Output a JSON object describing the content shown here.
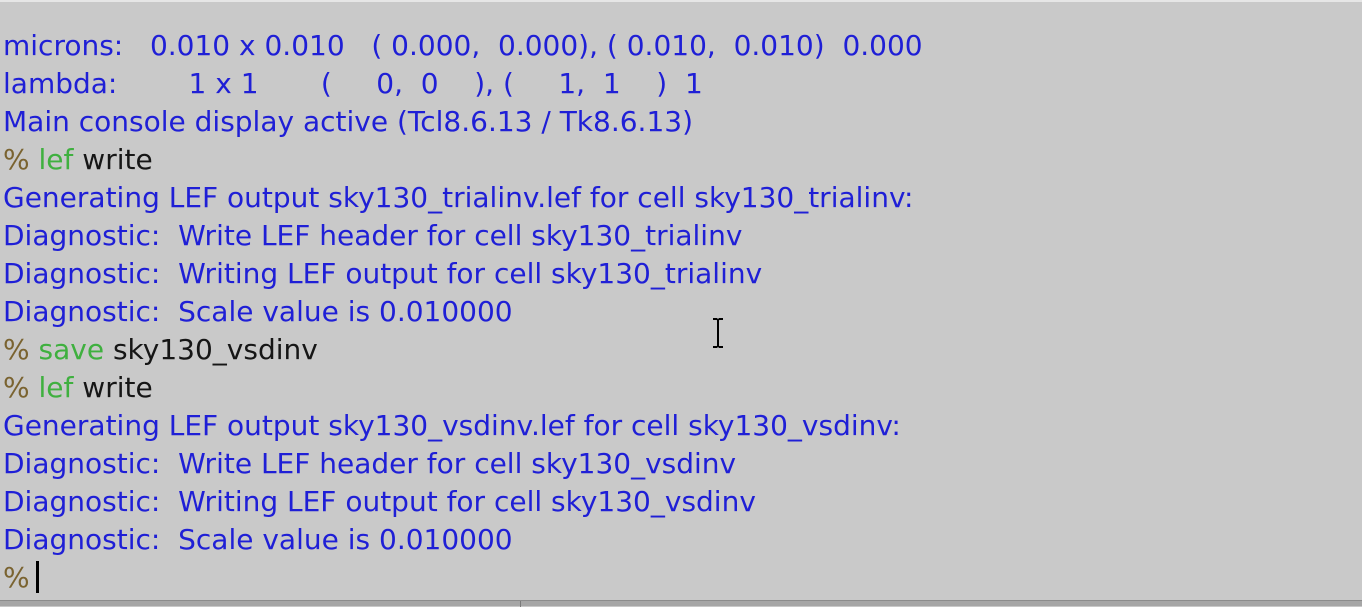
{
  "console": {
    "info_lines": [
      "microns:   0.010 x 0.010   ( 0.000,  0.000), ( 0.010,  0.010)  0.000",
      "lambda:        1 x 1       (     0,  0    ), (     1,  1    )  1",
      "Main console display active (Tcl8.6.13 / Tk8.6.13)"
    ],
    "prompt_symbol": "%",
    "commands": [
      {
        "name": "lef",
        "args": "write"
      },
      {
        "name": "save",
        "args": "sky130_vsdinv"
      },
      {
        "name": "lef",
        "args": "write"
      }
    ],
    "output_block_1": [
      "Generating LEF output sky130_trialinv.lef for cell sky130_trialinv:",
      "Diagnostic:  Write LEF header for cell sky130_trialinv",
      "Diagnostic:  Writing LEF output for cell sky130_trialinv",
      "Diagnostic:  Scale value is 0.010000"
    ],
    "output_block_2": [
      "Generating LEF output sky130_vsdinv.lef for cell sky130_vsdinv:",
      "Diagnostic:  Write LEF header for cell sky130_vsdinv",
      "Diagnostic:  Writing LEF output for cell sky130_vsdinv",
      "Diagnostic:  Scale value is 0.010000"
    ]
  },
  "colors": {
    "background": "#c9c9c9",
    "output_text": "#1f1fd6",
    "prompt": "#7a6330",
    "command_name": "#3fb03f",
    "command_args": "#161616"
  },
  "icons": {
    "cursor": "text-ibeam-cursor",
    "caret": "text-caret"
  }
}
